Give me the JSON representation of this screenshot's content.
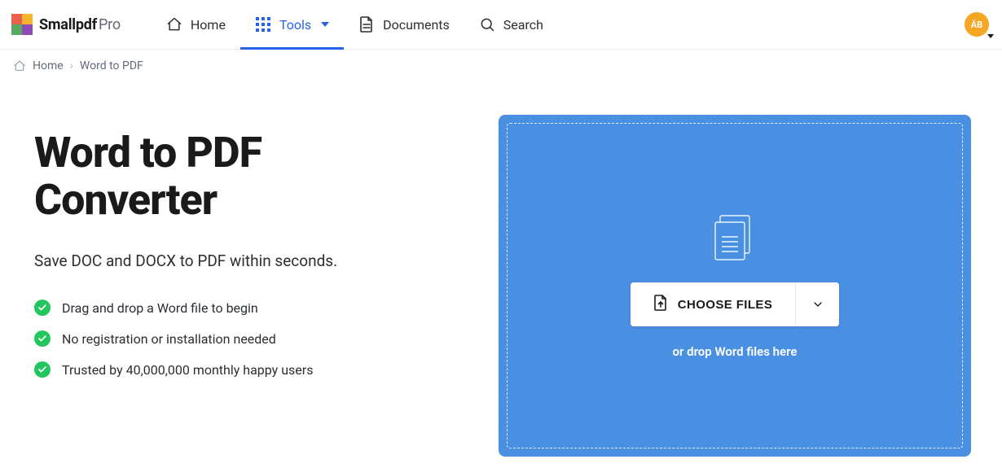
{
  "brand": {
    "name": "Smallpdf",
    "suffix": "Pro"
  },
  "nav": {
    "items": [
      {
        "label": "Home"
      },
      {
        "label": "Tools"
      },
      {
        "label": "Documents"
      },
      {
        "label": "Search"
      }
    ]
  },
  "avatar": {
    "initials": "ÄB"
  },
  "breadcrumb": {
    "home": "Home",
    "current": "Word to PDF"
  },
  "page": {
    "title": "Word to PDF Converter",
    "subtitle": "Save DOC and DOCX to PDF within seconds.",
    "features": [
      "Drag and drop a Word file to begin",
      "No registration or installation needed",
      "Trusted by 40,000,000 monthly happy users"
    ]
  },
  "drop": {
    "button_label": "CHOOSE FILES",
    "hint": "or drop Word files here"
  }
}
